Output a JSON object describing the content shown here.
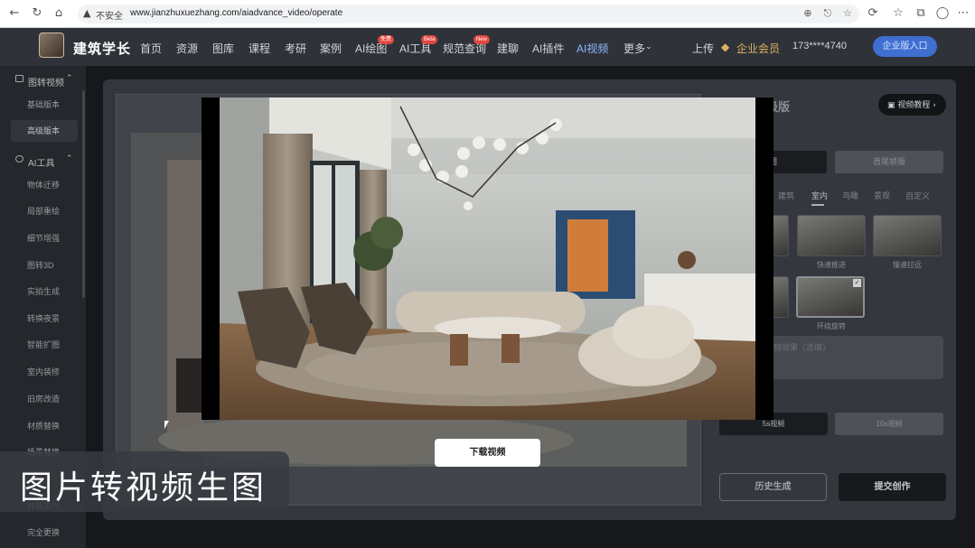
{
  "browser": {
    "security_label": "不安全",
    "url": "www.jianzhuxuezhang.com/aiadvance_video/operate",
    "buttons": [
      "back",
      "forward",
      "reload",
      "home"
    ],
    "icons": [
      "zoom-icon",
      "share-icon",
      "star-icon",
      "extensions-icon",
      "favorites-icon",
      "collections-icon",
      "profile-icon",
      "more-icon"
    ]
  },
  "nav": {
    "logo_text": "建筑学长",
    "items": [
      {
        "label": "首页"
      },
      {
        "label": "资源"
      },
      {
        "label": "图库"
      },
      {
        "label": "课程"
      },
      {
        "label": "考研"
      },
      {
        "label": "案例"
      },
      {
        "label": "AI绘图",
        "badge": "免费"
      },
      {
        "label": "AI工具",
        "badge": "Beta"
      },
      {
        "label": "规范查询",
        "badge": "New"
      },
      {
        "label": "建聊"
      },
      {
        "label": "AI插件"
      },
      {
        "label": "AI视频",
        "active": true
      },
      {
        "label": "更多"
      }
    ],
    "upload": "上传",
    "vip": "企业会员",
    "phone": "173****4740",
    "enterprise_btn": "企业版入口"
  },
  "sidebar": {
    "group1": {
      "label": "图转视频",
      "items": [
        "基础版本",
        "高级版本"
      ]
    },
    "group2": {
      "label": "AI工具",
      "items": [
        "物体迁移",
        "局部重绘",
        "细节增强",
        "图转3D",
        "实拍生成",
        "转换夜景",
        "智能扩图",
        "室内装修",
        "旧房改造",
        "材质替换",
        "场景替换",
        "转换天气",
        "完全更换"
      ]
    }
  },
  "panel": {
    "title": "级版",
    "tutorial_btn": "视频教程",
    "tab_left": "图",
    "tab_right": "首尾帧版",
    "categories": [
      "建筑",
      "室内",
      "鸟瞰",
      "景观",
      "自定义"
    ],
    "thumbs": [
      "快速推进",
      "慢速拉远",
      "环绕旋转"
    ],
    "prompt_placeholder": "频效果（选填）",
    "res_a": "5s视频",
    "res_b": "10s视频",
    "history_btn": "历史生成",
    "submit_btn": "提交创作"
  },
  "modal": {
    "download_btn": "下载视频"
  },
  "caption": "图片转视频生图",
  "colors": {
    "nav_bg": "#2f3339",
    "active_nav": "#8fb8ff",
    "vip_gold": "#e0b062",
    "badge_red": "#e0483e",
    "enterprise_blue": "#3e6fd1"
  }
}
